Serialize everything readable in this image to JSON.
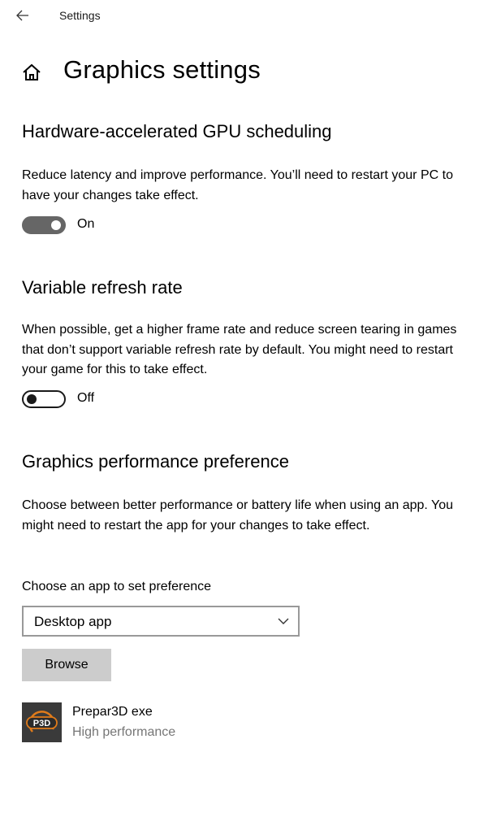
{
  "window": {
    "title": "Settings"
  },
  "page": {
    "title": "Graphics settings"
  },
  "gpu_scheduling": {
    "title": "Hardware-accelerated GPU scheduling",
    "description": "Reduce latency and improve performance. You’ll need to restart your PC to have your changes take effect.",
    "state": "On",
    "enabled": true
  },
  "variable_refresh": {
    "title": "Variable refresh rate",
    "description": "When possible, get a higher frame rate and reduce screen tearing in games that don’t support variable refresh rate by default. You might need to restart your game for this to take effect.",
    "state": "Off",
    "enabled": false
  },
  "performance_pref": {
    "title": "Graphics performance preference",
    "description": "Choose between better performance or battery life when using an app. You might need to restart the app for your changes to take effect.",
    "select_label": "Choose an app to set preference",
    "selected_app_type": "Desktop app",
    "browse_label": "Browse"
  },
  "apps": [
    {
      "logo_text": "P3D",
      "name": "Prepar3D exe",
      "preference": "High performance"
    }
  ],
  "icons": {
    "back": "back-arrow-icon",
    "home": "home-icon",
    "dropdown": "chevron-down-icon"
  },
  "colors": {
    "toggle_on": "#666666",
    "toggle_off_border": "#1a1a1a",
    "combo_border": "#999999",
    "button_bg": "#cccccc",
    "secondary_text": "#767676",
    "app_logo_accent": "#e07b1a"
  }
}
